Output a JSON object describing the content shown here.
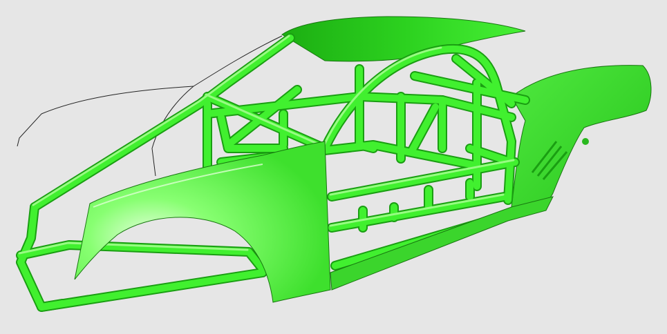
{
  "viewport": {
    "background": "#e6e6e6"
  },
  "model": {
    "type": "race-car-chassis-with-roll-cage",
    "colors": {
      "body_light": "#6dff5c",
      "body_mid": "#3ef02e",
      "body_dark": "#1fb815",
      "tube": "#41f02f",
      "tube_highlight": "#a6ff96",
      "tube_shadow": "#1a9e12",
      "outline": "#17750f",
      "glass_line": "#2a2a2a"
    }
  }
}
